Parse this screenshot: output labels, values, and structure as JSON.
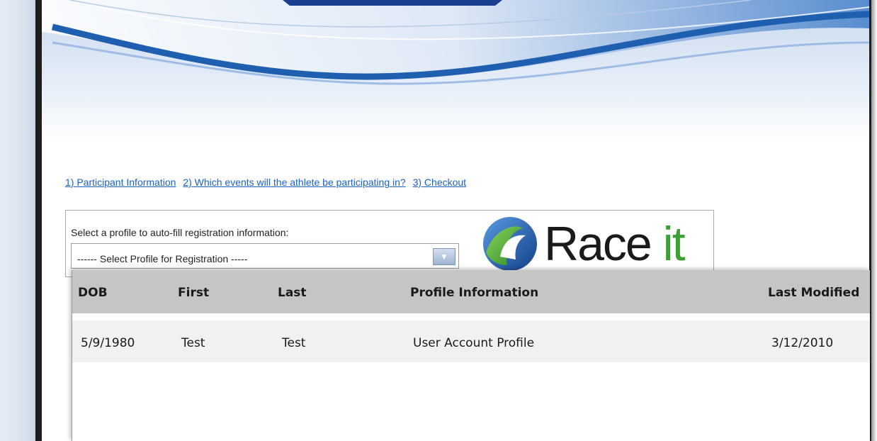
{
  "steps": [
    {
      "label": "1) Participant Information"
    },
    {
      "label": "2) Which events will the athlete be participating in?"
    },
    {
      "label": "3) Checkout"
    }
  ],
  "profile": {
    "label": "Select a profile to auto-fill registration information:",
    "selected": "------ Select Profile for Registration -----"
  },
  "logo": {
    "text_main": "Race ",
    "text_accent": "it"
  },
  "grid": {
    "columns": [
      "DOB",
      "First",
      "Last",
      "Profile Information",
      "Last Modified"
    ],
    "rows": [
      [
        "5/9/1980",
        "Test",
        "Test",
        "User Account Profile",
        "3/12/2010"
      ]
    ]
  },
  "colors": {
    "link": "#1b62c4",
    "logo_accent": "#3aa035",
    "header_bg": "#c5c5c5",
    "row_bg": "#f1f1f1",
    "banner_blue": "#1f5fb0"
  }
}
